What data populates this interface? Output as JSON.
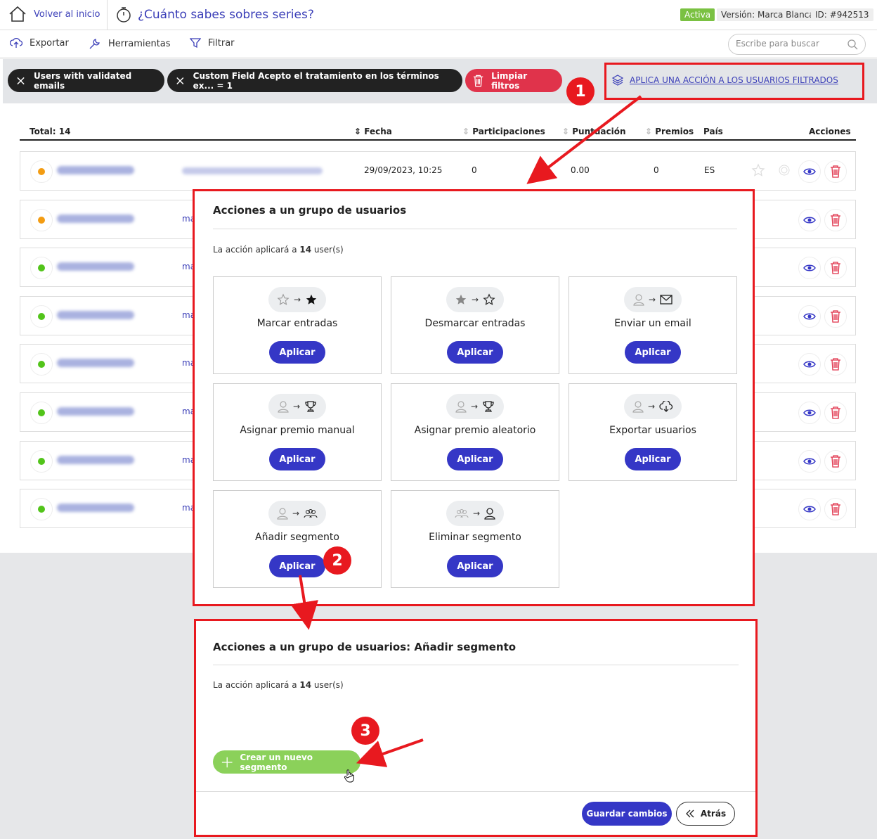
{
  "header": {
    "home_label": "Volver al inicio",
    "title": "¿Cuánto sabes sobres series?",
    "status": "Activa",
    "version_label": "Versión:",
    "version_value": "Marca Blanca",
    "id_label": "ID: #942513"
  },
  "toolbar": {
    "export": "Exportar",
    "tools": "Herramientas",
    "filter": "Filtrar",
    "search_placeholder": "Escribe para buscar"
  },
  "filters": {
    "chip1": "Users with validated emails",
    "chip2": "Custom Field Acepto el tratamiento en los términos ex... = 1",
    "clear": "Limpiar filtros",
    "apply_action": "APLICA UNA ACCIÓN A LOS USUARIOS FILTRADOS"
  },
  "markers": {
    "m1": "1",
    "m2": "2",
    "m3": "3"
  },
  "table": {
    "total": "Total: 14",
    "columns": {
      "fecha": "Fecha",
      "participaciones": "Participaciones",
      "puntuacion": "Puntuación",
      "premios": "Premios",
      "pais": "País",
      "acciones": "Acciones"
    },
    "first_row": {
      "fecha": "29/09/2023, 10:25",
      "participaciones": "0",
      "puntuacion": "0.00",
      "premios": "0",
      "pais": "ES"
    },
    "mail_prefix": "ma",
    "status_colors": [
      "#f39c12",
      "#f39c12",
      "#52c41a",
      "#52c41a",
      "#52c41a",
      "#52c41a",
      "#52c41a",
      "#52c41a"
    ]
  },
  "modal1": {
    "title": "Acciones a un grupo de usuarios",
    "applies_prefix": "La acción aplicará a",
    "applies_count": "14",
    "applies_suffix": "user(s)",
    "apply_btn": "Aplicar",
    "cards": [
      {
        "label": "Marcar entradas",
        "icon": "star-to-star-filled-icon"
      },
      {
        "label": "Desmarcar entradas",
        "icon": "star-filled-to-star-icon"
      },
      {
        "label": "Enviar un email",
        "icon": "user-to-mail-icon"
      },
      {
        "label": "Asignar premio manual",
        "icon": "user-to-trophy-icon"
      },
      {
        "label": "Asignar premio aleatorio",
        "icon": "user-to-trophy-icon"
      },
      {
        "label": "Exportar usuarios",
        "icon": "user-to-cloud-icon"
      },
      {
        "label": "Añadir segmento",
        "icon": "user-to-group-icon"
      },
      {
        "label": "Eliminar segmento",
        "icon": "group-to-user-icon"
      }
    ]
  },
  "modal2": {
    "title": "Acciones a un grupo de usuarios: Añadir segmento",
    "applies_prefix": "La acción aplicará a",
    "applies_count": "14",
    "applies_suffix": "user(s)",
    "create_segment": "Crear un nuevo segmento",
    "save": "Guardar cambios",
    "back": "Atrás"
  }
}
